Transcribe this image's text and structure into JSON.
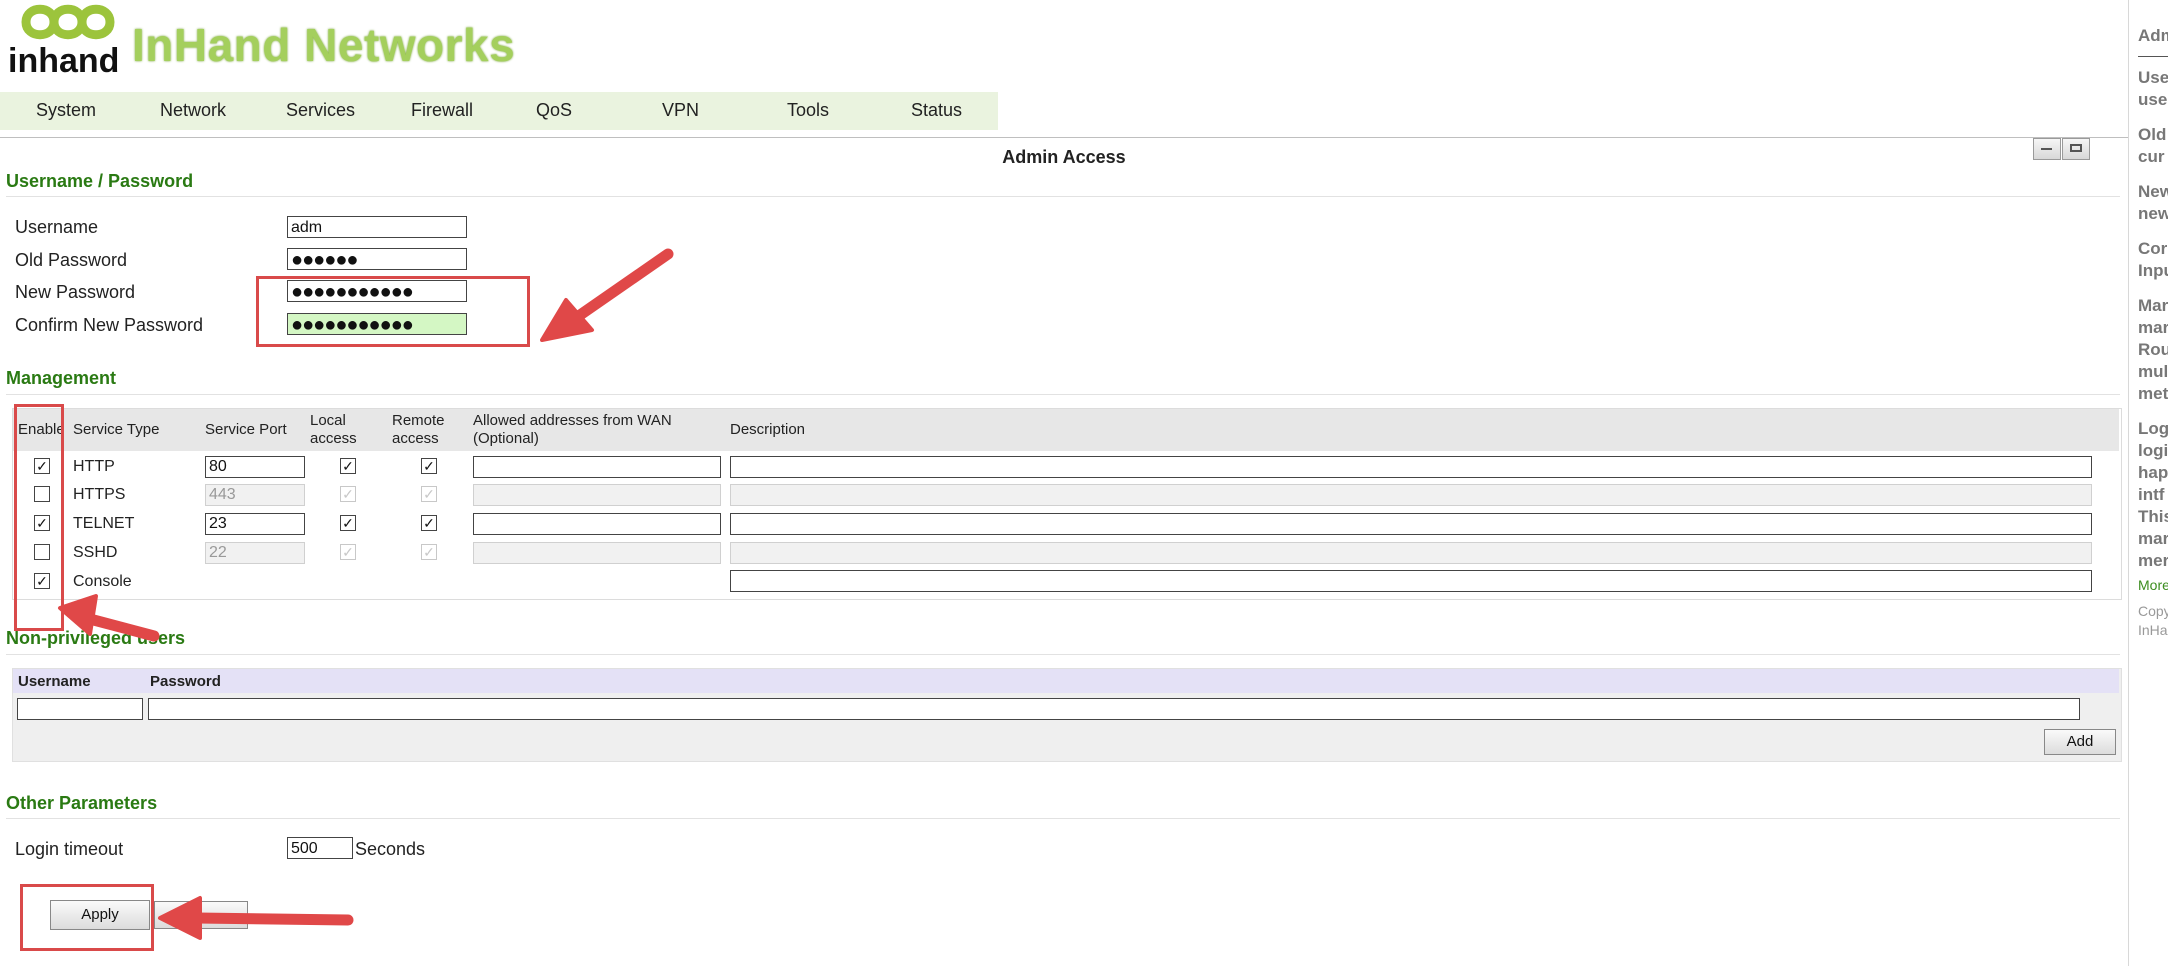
{
  "brand": {
    "logo_text": "inhand",
    "title": "InHand Networks"
  },
  "nav": [
    "System",
    "Network",
    "Services",
    "Firewall",
    "QoS",
    "VPN",
    "Tools",
    "Status"
  ],
  "page_title": "Admin Access",
  "credentials": {
    "section": "Username / Password",
    "username_label": "Username",
    "username_value": "adm",
    "old_password_label": "Old Password",
    "old_password_value": "●●●●●●",
    "new_password_label": "New Password",
    "new_password_value": "●●●●●●●●●●●",
    "confirm_label": "Confirm New Password",
    "confirm_value": "●●●●●●●●●●●"
  },
  "management": {
    "section": "Management",
    "headers": {
      "enable": "Enable",
      "service_type": "Service Type",
      "service_port": "Service Port",
      "local_access": "Local access",
      "remote_access": "Remote access",
      "allowed": "Allowed addresses from WAN (Optional)",
      "description": "Description"
    },
    "rows": [
      {
        "service": "HTTP",
        "enabled": true,
        "port": "80",
        "local": true,
        "remote": true,
        "disabled": false
      },
      {
        "service": "HTTPS",
        "enabled": false,
        "port": "443",
        "local": true,
        "remote": true,
        "disabled": true
      },
      {
        "service": "TELNET",
        "enabled": true,
        "port": "23",
        "local": true,
        "remote": true,
        "disabled": false
      },
      {
        "service": "SSHD",
        "enabled": false,
        "port": "22",
        "local": true,
        "remote": true,
        "disabled": true
      },
      {
        "service": "Console",
        "enabled": true
      }
    ]
  },
  "non_privileged": {
    "section": "Non-privileged users",
    "username_header": "Username",
    "password_header": "Password",
    "add_button": "Add"
  },
  "other": {
    "section": "Other Parameters",
    "login_timeout_label": "Login timeout",
    "login_timeout_value": "500",
    "unit": "Seconds"
  },
  "apply_button": "Apply",
  "help": {
    "lines": [
      "Adm",
      "Use",
      "use",
      "Old",
      "cur",
      "New",
      "new",
      "Cor",
      "Inpu",
      "Mar",
      "mar",
      "Rou",
      "mul",
      "met",
      "Log",
      "logi",
      "hap",
      "intf",
      "This",
      "mar",
      "mer"
    ],
    "more": "More",
    "copy1": "Copy",
    "copy2": "InHa"
  },
  "colors": {
    "section_green": "#2a7a13",
    "annotation_red": "#d94a4a",
    "nav_bg": "#eaf3df"
  }
}
